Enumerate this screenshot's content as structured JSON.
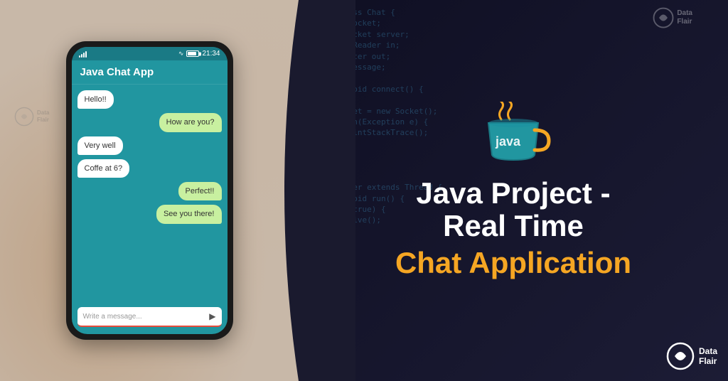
{
  "left": {
    "phone": {
      "status_bar": {
        "time": "21:34",
        "signal": "signal"
      },
      "app_title": "Java Chat App",
      "messages": [
        {
          "id": 1,
          "text": "Hello!!",
          "side": "left"
        },
        {
          "id": 2,
          "text": "How are you?",
          "side": "right"
        },
        {
          "id": 3,
          "text": "Very well",
          "side": "left"
        },
        {
          "id": 4,
          "text": "Coffe at 6?",
          "side": "left"
        },
        {
          "id": 5,
          "text": "Perfect!!",
          "side": "right"
        },
        {
          "id": 6,
          "text": "See you there!",
          "side": "right"
        }
      ],
      "input_placeholder": "Write a message...",
      "send_icon": "▶"
    }
  },
  "right": {
    "title_line1": "Java Project -",
    "title_line2": "Real Time",
    "subtitle": "Chat Application",
    "brand": {
      "name_line1": "Data",
      "name_line2": "Flair"
    }
  },
  "brand": {
    "name_line1": "Data",
    "name_line2": "Flair"
  },
  "colors": {
    "phone_bg": "#2196a0",
    "phone_bar": "#1a7a85",
    "bubble_left": "#ffffff",
    "bubble_right": "#c8f0a0",
    "title_color": "#ffffff",
    "subtitle_color": "#f5a623",
    "accent_orange": "#f5a623",
    "accent_blue": "#2196a0"
  }
}
